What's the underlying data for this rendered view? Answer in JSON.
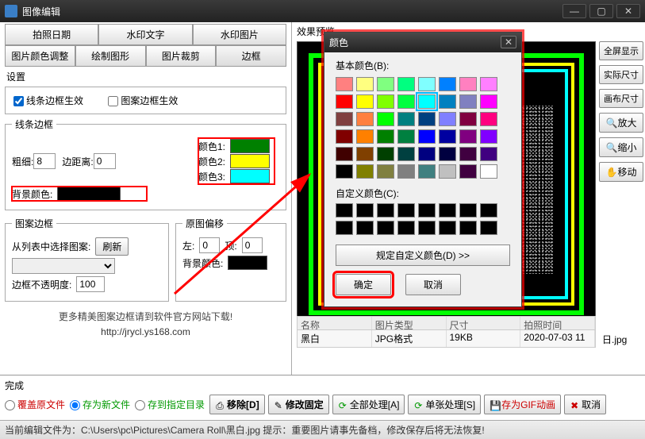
{
  "window": {
    "title": "图像编辑"
  },
  "tabs_row1": [
    "拍照日期",
    "水印文字",
    "水印图片"
  ],
  "tabs_row2": [
    "图片颜色调整",
    "绘制图形",
    "图片裁剪",
    "边框"
  ],
  "preview_label": "效果预览",
  "settings_legend": "设置",
  "chk_line_border": "线条边框生效",
  "chk_pattern_border": "图案边框生效",
  "line_border": {
    "legend": "线条边框",
    "thick_label": "粗细:",
    "thick": "8",
    "margin_label": "边距离:",
    "margin": "0",
    "color1_label": "颜色1:",
    "color1": "#008000",
    "color2_label": "颜色2:",
    "color2": "#ffff00",
    "color3_label": "颜色3:",
    "color3": "#00ffff",
    "bgcolor_label": "背景颜色:",
    "bgcolor": "#000000"
  },
  "pattern_border": {
    "legend": "图案边框",
    "select_label": "从列表中选择图案:",
    "refresh": "刷新",
    "opacity_label": "边框不透明度:",
    "opacity": "100",
    "offset_legend": "原图偏移",
    "left_label": "左:",
    "left": "0",
    "top_label": "顶:",
    "top": "0",
    "bg_label": "背景颜色:",
    "bg": "#000000"
  },
  "promo": {
    "line1": "更多精美图案边框请到软件官方网站下载!",
    "line2": "http://jrycl.ys168.com"
  },
  "info_headers": [
    "名称",
    "图片类型",
    "尺寸",
    "拍照时间"
  ],
  "info_values": [
    "黑白",
    "JPG格式",
    "19KB",
    "2020-07-03 11"
  ],
  "info_extra": "日.jpg",
  "sidebar": {
    "fullscreen": "全屏显示",
    "actual": "实际尺寸",
    "canvas": "画布尺寸",
    "zoomin": "放大",
    "zoomout": "缩小",
    "move": "移动"
  },
  "bottom": {
    "done_label": "完成",
    "r_overwrite": "覆盖原文件",
    "r_saveas": "存为新文件",
    "r_savedir": "存到指定目录",
    "btn_remove": "移除[D]",
    "btn_fix": "修改固定",
    "btn_all": "全部处理[A]",
    "btn_single": "单张处理[S]",
    "btn_gif": "存为GIF动画",
    "btn_cancel": "取消"
  },
  "status": "当前编辑文件为：C:\\Users\\pc\\Pictures\\Camera Roll\\黑白.jpg  提示：重要图片请事先备档，修改保存后将无法恢复!",
  "color_dialog": {
    "title": "颜色",
    "basic_label": "基本颜色(B):",
    "custom_label": "自定义颜色(C):",
    "define_btn": "规定自定义颜色(D) >>",
    "ok": "确定",
    "cancel": "取消",
    "palette": [
      "#ff8080",
      "#ffff80",
      "#80ff80",
      "#00ff80",
      "#80ffff",
      "#0080ff",
      "#ff80c0",
      "#ff80ff",
      "#ff0000",
      "#ffff00",
      "#80ff00",
      "#00ff40",
      "#00ffff",
      "#0080c0",
      "#8080c0",
      "#ff00ff",
      "#804040",
      "#ff8040",
      "#00ff00",
      "#008080",
      "#004080",
      "#8080ff",
      "#800040",
      "#ff0080",
      "#800000",
      "#ff8000",
      "#008000",
      "#008040",
      "#0000ff",
      "#0000a0",
      "#800080",
      "#8000ff",
      "#400000",
      "#804000",
      "#004000",
      "#004040",
      "#000080",
      "#000040",
      "#400040",
      "#400080",
      "#000000",
      "#808000",
      "#808040",
      "#808080",
      "#408080",
      "#c0c0c0",
      "#400040",
      "#ffffff"
    ]
  }
}
